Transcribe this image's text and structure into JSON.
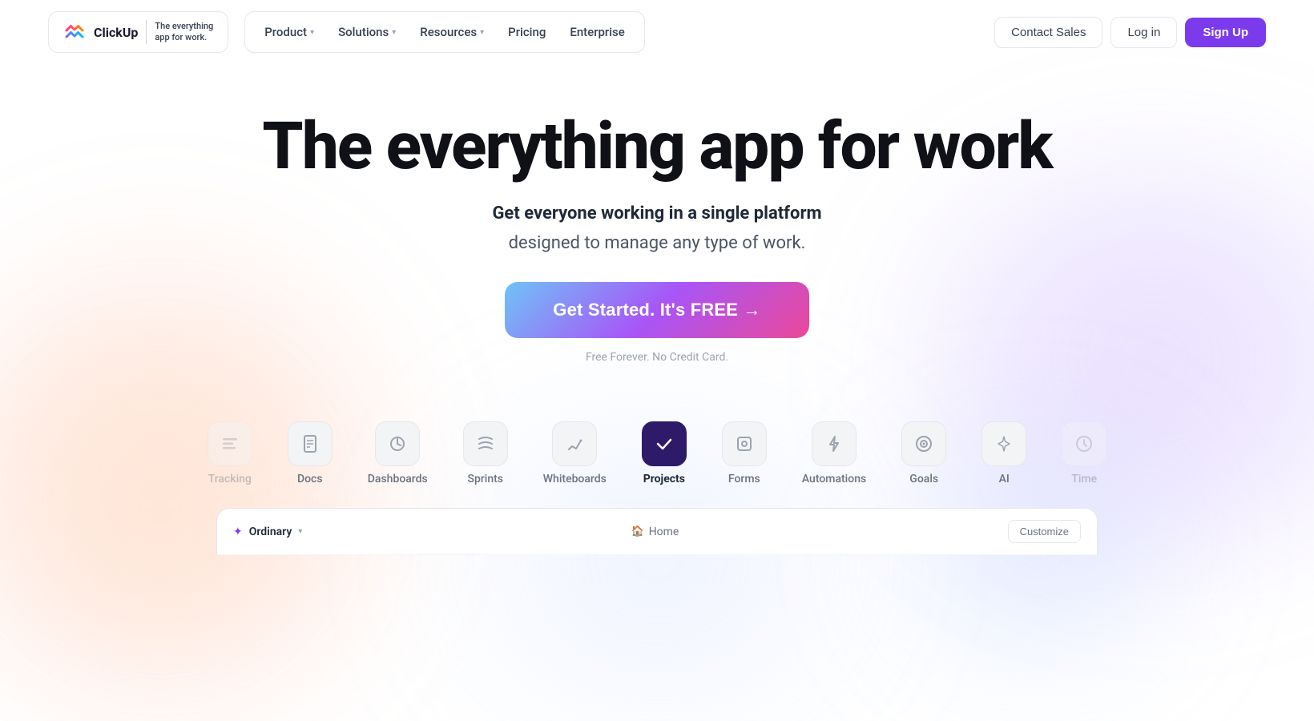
{
  "navbar": {
    "logo_brand": "ClickUp",
    "logo_tagline": "The everything\napp for work.",
    "nav_items": [
      {
        "label": "Product",
        "has_dropdown": true
      },
      {
        "label": "Solutions",
        "has_dropdown": true
      },
      {
        "label": "Resources",
        "has_dropdown": true
      },
      {
        "label": "Pricing",
        "has_dropdown": false
      },
      {
        "label": "Enterprise",
        "has_dropdown": false
      }
    ],
    "contact_sales": "Contact Sales",
    "login": "Log in",
    "signup": "Sign Up"
  },
  "hero": {
    "title": "The everything app for work",
    "subtitle_bold": "Get everyone working in a single platform",
    "subtitle_regular": "designed to manage any type of work.",
    "cta_button": "Get Started. It's FREE →",
    "fine_print": "Free Forever. No Credit Card."
  },
  "feature_tabs": [
    {
      "id": "tracking",
      "label": "Tracking",
      "icon": "≡",
      "active": false,
      "partial": true
    },
    {
      "id": "docs",
      "label": "Docs",
      "icon": "📄",
      "active": false,
      "partial": false
    },
    {
      "id": "dashboards",
      "label": "Dashboards",
      "icon": "🎧",
      "active": false,
      "partial": false
    },
    {
      "id": "sprints",
      "label": "Sprints",
      "icon": "≋",
      "active": false,
      "partial": false
    },
    {
      "id": "whiteboards",
      "label": "Whiteboards",
      "icon": "✏",
      "active": false,
      "partial": false
    },
    {
      "id": "projects",
      "label": "Projects",
      "icon": "✓",
      "active": true,
      "partial": false
    },
    {
      "id": "forms",
      "label": "Forms",
      "icon": "⊡",
      "active": false,
      "partial": false
    },
    {
      "id": "automations",
      "label": "Automations",
      "icon": "⚡",
      "active": false,
      "partial": false
    },
    {
      "id": "goals",
      "label": "Goals",
      "icon": "◎",
      "active": false,
      "partial": false
    },
    {
      "id": "ai",
      "label": "AI",
      "icon": "✦",
      "active": false,
      "partial": false
    },
    {
      "id": "time",
      "label": "Time",
      "icon": "⏱",
      "active": false,
      "partial": true
    }
  ],
  "preview": {
    "workspace_name": "Ordinary",
    "home_label": "Home",
    "customize_label": "Customize"
  }
}
